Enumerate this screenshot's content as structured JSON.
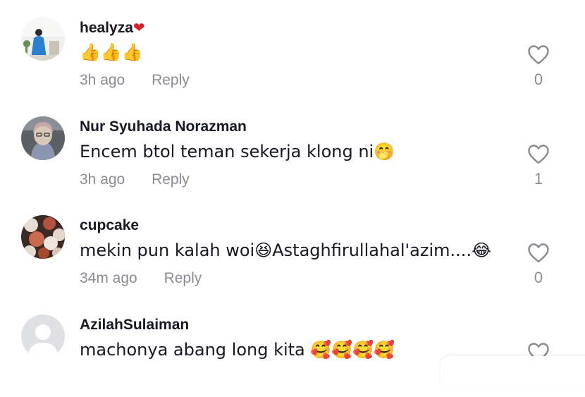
{
  "comments": [
    {
      "username": "healyza",
      "username_suffix": "❤",
      "text": "👍👍👍",
      "time": "3h ago",
      "reply_label": "Reply",
      "likes": "0"
    },
    {
      "username": "Nur Syuhada Norazman",
      "text": "Encem btol teman sekerja klong ni🤭",
      "time": "3h ago",
      "reply_label": "Reply",
      "likes": "1"
    },
    {
      "username": "cupcake",
      "text": "mekin pun kalah woi😆Astaghfirullahal'azim....😂",
      "time": "34m ago",
      "reply_label": "Reply",
      "likes": "0"
    },
    {
      "username": "AzilahSulaiman",
      "text": "machonya abang long kita 🥰🥰🥰🥰",
      "time": "",
      "reply_label": "",
      "likes": ""
    }
  ],
  "colors": {
    "primary_text": "#161823",
    "secondary_text": "#8a8b91",
    "heart_red": "#d8212c"
  },
  "icons": {
    "like": "heart-outline-icon",
    "avatar_placeholder": "default-user-avatar-icon"
  }
}
